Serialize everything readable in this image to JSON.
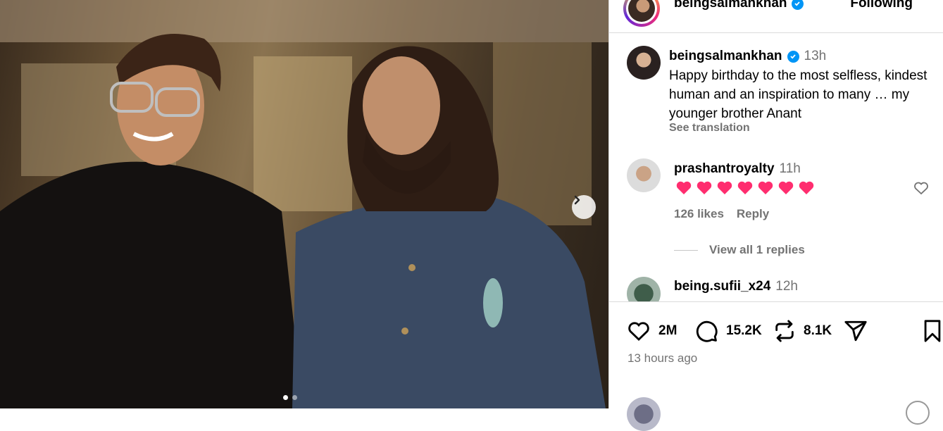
{
  "post": {
    "author": "beingsalmankhan",
    "follow_label": "Following",
    "carousel": {
      "current": 1,
      "total": 2
    }
  },
  "caption": {
    "username": "beingsalmankhan",
    "time": "13h",
    "text": "Happy birthday to the most selfless, kindest human and an inspiration to many … my younger brother Anant",
    "translation_label": "See translation"
  },
  "comments": [
    {
      "username": "prashantroyalty",
      "time": "11h",
      "text": "💗💗💗💗💗💗💗",
      "likes": "126 likes",
      "reply_label": "Reply",
      "view_replies": "View all 1 replies"
    },
    {
      "username": "being.sufii_x24",
      "time": "12h"
    }
  ],
  "actions": {
    "likes": "2M",
    "comments": "15.2K",
    "reposts": "8.1K"
  },
  "posted_ago": "13 hours ago",
  "colors": {
    "verified": "#0095f6",
    "muted": "#737373",
    "heart_emoji": "#ff2d6f"
  },
  "icons": [
    "heart-icon",
    "comment-icon",
    "repost-icon",
    "share-icon",
    "bookmark-icon",
    "chevron-right-icon",
    "verified-badge-icon"
  ]
}
